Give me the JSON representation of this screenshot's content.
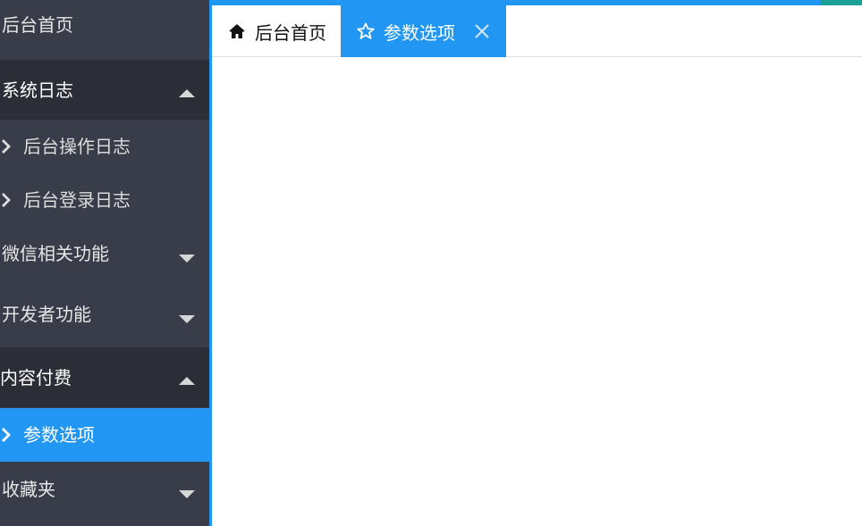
{
  "sidebar": {
    "items": [
      {
        "label": "后台首页"
      },
      {
        "label": "系统日志",
        "state": "expanded"
      },
      {
        "label": "后台操作日志"
      },
      {
        "label": "后台登录日志"
      },
      {
        "label": "微信相关功能",
        "state": "collapsed"
      },
      {
        "label": "开发者功能",
        "state": "collapsed"
      },
      {
        "label": "内容付费",
        "state": "expanded"
      },
      {
        "label": "参数选项",
        "state": "active"
      },
      {
        "label": "收藏夹",
        "state": "collapsed"
      }
    ]
  },
  "tabs": [
    {
      "label": "后台首页",
      "icon": "home-icon"
    },
    {
      "label": "参数选项",
      "icon": "star-outline-icon",
      "active": true
    }
  ],
  "colors": {
    "sidebar_bg": "#393d49",
    "sidebar_open_bg": "#2b2e37",
    "accent": "#2196f3",
    "corner_accent": "#1aa094"
  }
}
